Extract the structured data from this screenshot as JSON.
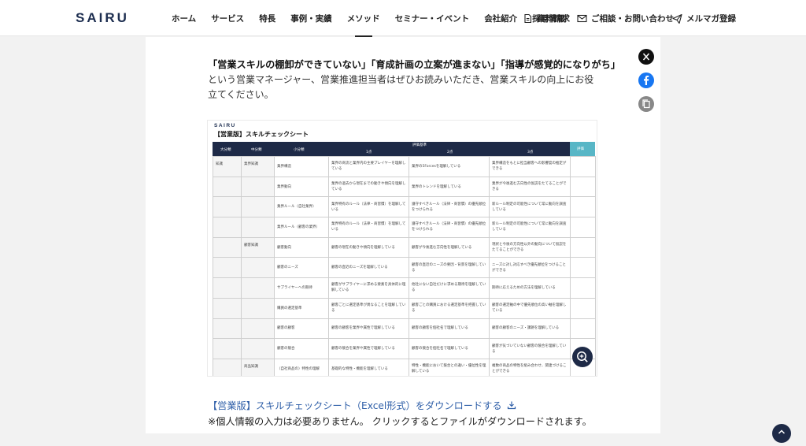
{
  "header": {
    "logo": "SAIRU",
    "nav": [
      "ホーム",
      "サービス",
      "特長",
      "事例・実績",
      "メソッド",
      "セミナー・イベント",
      "会社紹介",
      "採用情報"
    ],
    "active_nav": "メソッド",
    "docs_label": "資料請求",
    "contact_label": "ご相談・お問い合わせ",
    "newsletter_label": "メルマガ登録"
  },
  "article": {
    "lead_bold": "「営業スキルの棚卸ができていない」「育成計画の立案が進まない」「指導が感覚的になりがち」",
    "lead": "という営業マネージャー、営業推進担当者はぜひお読みいただき、営業スキルの向上にお役立てください。",
    "download_link": "【営業版】スキルチェックシート（Excel形式）をダウンロードする",
    "note": "※個人情報の入力は必要ありません。 クリックするとファイルがダウンロードされます。"
  },
  "sheet": {
    "logo": "SAIRU",
    "title": "【営業版】スキルチェックシート",
    "headers": {
      "large": "大分類",
      "mid": "中分類",
      "small": "小分類",
      "criteria": "評価基準",
      "score1": "1点",
      "score2": "2点",
      "score3": "3点",
      "memo": "評価"
    },
    "rows": [
      {
        "l1": "知識",
        "l2": "業界知識",
        "l3": "業界構造",
        "c1": "業界の商流と業界内の主要プレイヤーを理解している",
        "c2": "業界の5Forcesを理解している",
        "c3": "業界構造をもとに担当顧客への影響度の推定ができる"
      },
      {
        "l1": "",
        "l2": "",
        "l3": "業界動向",
        "c1": "業界の過去から現在までの動きや傾向を理解している",
        "c2": "業界のトレンドを理解している",
        "c3": "業界が今後進む方向性の仮説をたてることができる"
      },
      {
        "l1": "",
        "l2": "",
        "l3": "業界ルール（自社業界）",
        "c1": "業界特有のルール（法律・商習慣）を理解している",
        "c2": "遵守すべきルール（法律・商習慣）の優先順位をつけられる",
        "c3": "新ルール制定の可能性について常に動向を調査している"
      },
      {
        "l1": "",
        "l2": "",
        "l3": "業界ルール（顧客の業界）",
        "c1": "業界特有のルール（法律・商習慣）を理解している",
        "c2": "遵守すべきルール（法律・商習慣）の優先順位をつけられる",
        "c3": "新ルール制定の可能性について常に動向を調査している"
      },
      {
        "l1": "",
        "l2": "顧客知識",
        "l3": "顧客動向",
        "c1": "顧客の現在の動きや傾向を理解している",
        "c2": "顧客が今後進む方向性を理解している",
        "c3": "現状と今後の方向性以外の動向について仮説をたてることができる"
      },
      {
        "l1": "",
        "l2": "",
        "l3": "顧客のニーズ",
        "c1": "顧客の直近のニーズを理解している",
        "c2": "顧客の直近のニーズの要因・背景を理解している",
        "c3": "ニーズに対し対応すべき優先順位をつけることができる"
      },
      {
        "l1": "",
        "l2": "",
        "l3": "サプライヤーへの期待",
        "c1": "顧客がサプライヤーに求める要素を具体的に理解している",
        "c2": "他社にない自社だけに求める期待を理解している",
        "c3": "期待に応えるための方法を理解している"
      },
      {
        "l1": "",
        "l2": "",
        "l3": "購買の選定基準",
        "c1": "顧客ごとに選定基準が異なることを理解している",
        "c2": "顧客ごとの購買における選定基準を把握している",
        "c3": "顧客の選定軸の中で優先順位の高い軸を理解している"
      },
      {
        "l1": "",
        "l2": "",
        "l3": "顧客の顧客",
        "c1": "顧客の顧客を業界や属性で理解している",
        "c2": "顧客の顧客を個社名で理解している",
        "c3": "顧客の顧客のニーズ・課題を理解している"
      },
      {
        "l1": "",
        "l2": "",
        "l3": "顧客の競合",
        "c1": "顧客の競合を業界や属性で理解している",
        "c2": "顧客の競合を個社名で理解している",
        "c3": "顧客が気づいていない顧客の競合を理解している"
      },
      {
        "l1": "",
        "l2": "商品知識",
        "l3": "（自社商品の）特性の理解",
        "c1": "基礎的な特性・機能を理解している",
        "c2": "特性・機能において競合との違い・優位性を理解している",
        "c3": "複数の商品の特性を組み合わせ、関連づけることができる"
      }
    ]
  },
  "colors": {
    "brand_navy": "#1e2a47",
    "accent_teal": "#58b6c6",
    "link_blue": "#2f5fa8",
    "facebook_blue": "#1877f2"
  },
  "icons": {
    "docs": "document-icon",
    "contact": "mail-icon",
    "newsletter": "paper-plane-icon",
    "download": "download-icon",
    "zoom": "zoom-in-icon",
    "share_x": "x-logo-icon",
    "share_facebook": "facebook-icon",
    "share_copy": "copy-icon",
    "to_top": "arrow-up-icon"
  }
}
